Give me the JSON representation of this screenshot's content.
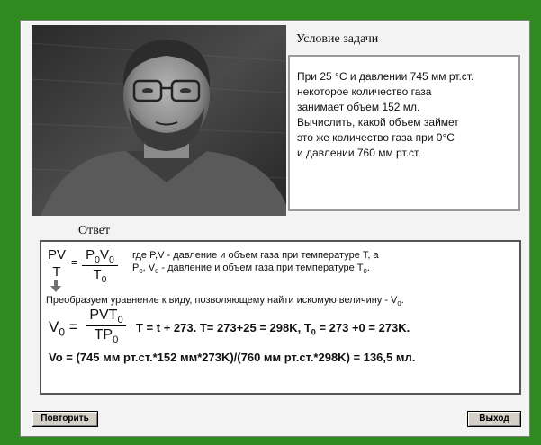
{
  "condition": {
    "title": "Условие задачи",
    "lines": [
      "При 25 °C и давлении 745 мм рт.ст.",
      "некоторое количество газа",
      "занимает объем 152 мл.",
      "Вычислить, какой объем займет",
      "это же количество газа при 0°C",
      "и давлении 760 мм рт.ст."
    ]
  },
  "answer": {
    "title": "Ответ",
    "note_line1": "где P,V - давление и объем газа при температуре T, а",
    "note_line2_a": "P",
    "note_line2_b": "0",
    "note_line2_c": ", V",
    "note_line2_d": "0",
    "note_line2_e": " - давление и объем газа при температуре T",
    "note_line2_f": "0",
    "note_line2_g": ".",
    "transform_text": "Преобразуем уравнение к виду, позволяющему найти искомую величину - V",
    "transform_sub": "0",
    "transform_end": ".",
    "formula_eq": "T = t + 273.  T= 273+25 = 298K,  T",
    "formula_t0_sub": "0",
    "formula_eq_end": " = 273 +0 = 273K.",
    "result_line": "Vo = (745 мм рт.ст.*152 мм*273K)/(760 мм рт.ст.*298K) = 136,5 мл."
  },
  "buttons": {
    "repeat": "Повторить",
    "exit": "Выход"
  },
  "colors": {
    "background": "#2f8a20",
    "panel": "#f3f3f3",
    "arrow": "#707070"
  }
}
